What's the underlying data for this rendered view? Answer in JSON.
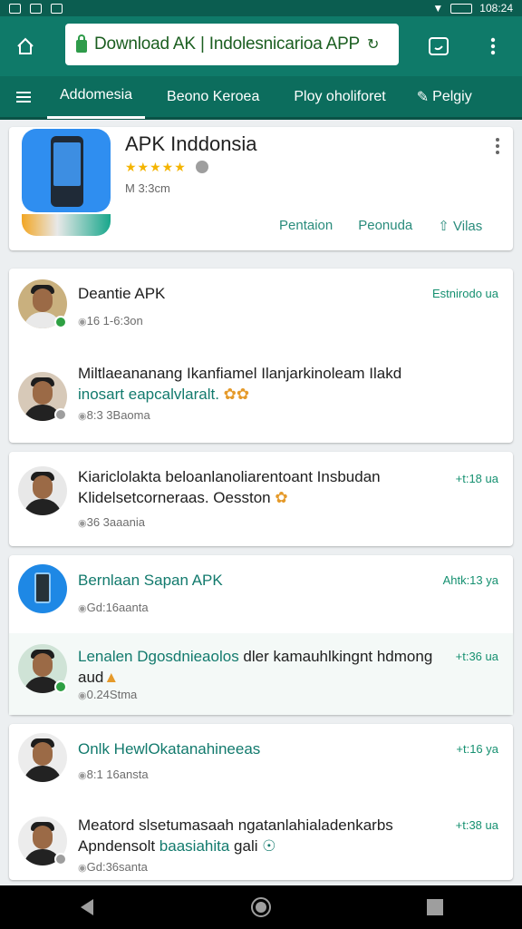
{
  "statusbar": {
    "time": "108:24"
  },
  "toolbar": {
    "url": "Download AK | Indolesnicarioa APP",
    "home_icon": "home-icon",
    "tabs_icon": "tabs-icon",
    "menu_icon": "kebab-icon"
  },
  "tabs": [
    "Addomesia",
    "Beono Keroea",
    "Ploy oholiforet",
    "Pelgiy"
  ],
  "app": {
    "title": "APK Inddonsia",
    "stars": "★★★★★",
    "meta": "M 3:3cm",
    "actions": [
      "Pentaion",
      "Peonuda",
      "Vilas"
    ]
  },
  "posts": [
    {
      "rows": [
        {
          "name": "Deantie APK",
          "sub": "16 1-6:3on",
          "time": "Estnirodo ua"
        },
        {
          "line1": "Miltlaeananang Ikanfiamel Ilanjarkinoleam Ilakd",
          "line2a": "inosart eapcalvlaralt.",
          "line2b": "",
          "sub": "8:3 3Baoma",
          "time": ""
        }
      ]
    },
    {
      "rows": [
        {
          "line1": "Kiariclolakta beloanlanoliarentoant Insbudan",
          "line2a": "Klidelsetcorneraas. Oesston",
          "line2b": "",
          "sub": "36 3aaania",
          "time": "+t:18 ua"
        }
      ]
    },
    {
      "rows": [
        {
          "name": "Bernlaan Sapan APK",
          "sub": "Gd:16aanta",
          "time": "Ahtk:13 ya"
        },
        {
          "line1a": "Lenalen Dgosdnieaolos",
          "line1b": " dler kamauhlkingnt hdmong",
          "line2": "aud",
          "sub": "0.24Stma",
          "time": "+t:36 ua"
        }
      ]
    },
    {
      "rows": [
        {
          "name": "Onlk HewlOkatanahineeas",
          "sub": "8:1 16ansta",
          "time": "+t:16 ya"
        },
        {
          "line1": "Meatord slsetumasaah ngatanlahialadenkarbs",
          "line2a": "Apndensolt",
          "line2b": " baasiahita",
          "line2c": " gali",
          "sub": "Gd:36santa",
          "time": "+t:38 ua"
        }
      ]
    }
  ],
  "navbar": {
    "back": "back-icon",
    "home": "home-circle-icon",
    "recents": "recents-icon"
  }
}
